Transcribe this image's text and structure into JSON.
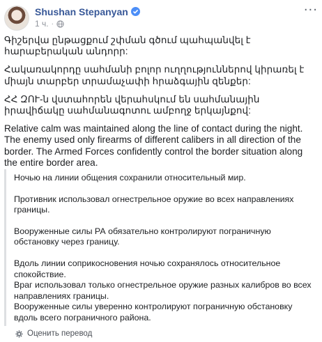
{
  "post": {
    "author": "Shushan Stepanyan",
    "time": "1 ч.",
    "separator": "·",
    "more_label": "···",
    "icons": {
      "verified": "verified-badge-icon",
      "audience": "globe-icon",
      "more": "more-icon",
      "settings": "gear-icon"
    },
    "paragraphs_hy": [
      "Գիշերվա ընթացքում շփման գծում պահպանվել է հարաբերական անդորր:",
      "Հակառակորդը սահմանի բոլոր ուղղություններով կիրառել է միայն տարբեր տրամաչափի հրաձգային զենքեր:",
      "ՀՀ ԶՈՒ-ն վստահորեն վերահսկում են սահմանային իրավիճակը սահմանագոտու ամբողջ երկայնքով:"
    ],
    "paragraph_en": "Relative calm was maintained along the line of contact during the night. The enemy used only firearms of different calibers in all direction of the border. The Armed Forces confidently control the border situation along the entire border area."
  },
  "translation": {
    "p1": "Ночью на линии общения сохранили относительный мир.",
    "p2": "Противник использовал огнестрельное оружие во всех направлениях границы.",
    "p3": "Вооруженные силы РА обязательно контролируют пограничную обстановку через границу.",
    "p4": "Вдоль линии соприкосновения ночью сохранялось относительное спокойствие.",
    "p5": "Враг использовал только огнестрельное оружие разных калибров во всех направлениях границы.",
    "p6": "Вооруженные силы уверенно контролируют пограничную обстановку вдоль всего пограничного района.",
    "rate_label": "Оценить перевод"
  }
}
